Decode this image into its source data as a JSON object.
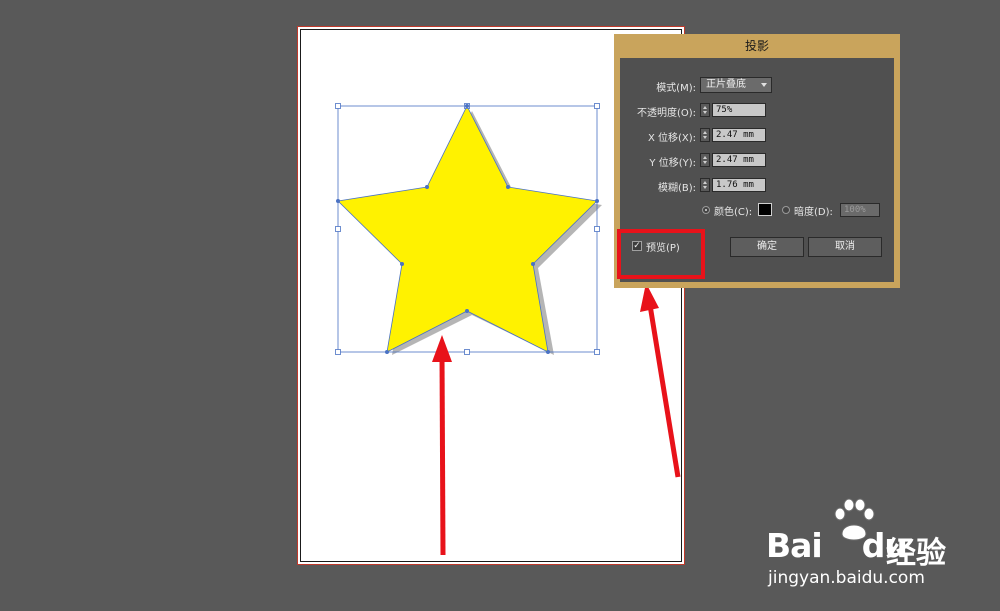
{
  "dialog": {
    "title": "投影",
    "mode": {
      "label": "模式(M):",
      "value": "正片叠底"
    },
    "opacity": {
      "label": "不透明度(O):",
      "value": "75%"
    },
    "x_offset": {
      "label": "X 位移(X):",
      "value": "2.47 mm"
    },
    "y_offset": {
      "label": "Y 位移(Y):",
      "value": "2.47 mm"
    },
    "blur": {
      "label": "模糊(B):",
      "value": "1.76 mm"
    },
    "color_option": {
      "label": "颜色(C):",
      "selected": true,
      "swatch": "#000000"
    },
    "darkness_option": {
      "label": "暗度(D):",
      "value": "100%",
      "selected": false
    },
    "preview": {
      "label": "预览(P)",
      "checked": true,
      "check_glyph": "✓"
    },
    "ok_label": "确定",
    "cancel_label": "取消"
  },
  "canvas": {
    "star_fill": "#fff200",
    "selection_color": "#4a72c4",
    "artboard_border": "#c0392b"
  },
  "annotations": {
    "color": "#e8121a"
  },
  "watermark": {
    "brand": "Bai",
    "brand_suffix": "du",
    "subtitle": "经验",
    "url": "jingyan.baidu.com"
  }
}
